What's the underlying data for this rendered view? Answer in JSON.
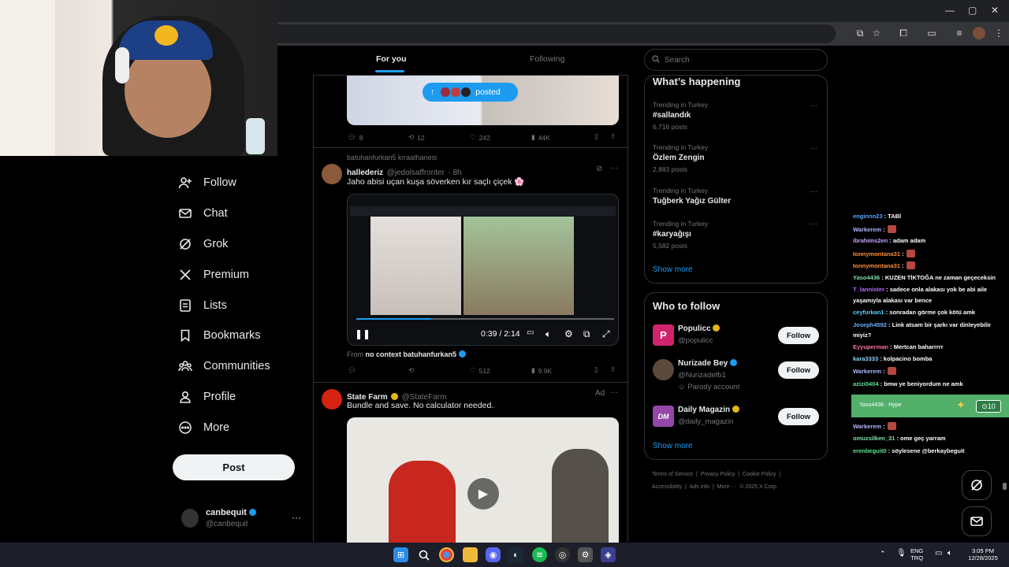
{
  "browser": {
    "window_controls": {
      "minimize": "—",
      "maximize": "▢",
      "close": "✕"
    }
  },
  "nav": {
    "items": [
      {
        "label": "Follow",
        "icon": "add-user-icon"
      },
      {
        "label": "Chat",
        "icon": "mail-icon"
      },
      {
        "label": "Grok",
        "icon": "grok-icon"
      },
      {
        "label": "Premium",
        "icon": "x-logo-icon"
      },
      {
        "label": "Lists",
        "icon": "list-icon"
      },
      {
        "label": "Bookmarks",
        "icon": "bookmark-icon"
      },
      {
        "label": "Communities",
        "icon": "communities-icon"
      },
      {
        "label": "Profile",
        "icon": "person-icon"
      },
      {
        "label": "More",
        "icon": "more-circle-icon"
      }
    ],
    "post_label": "Post",
    "account": {
      "name": "canbequit",
      "handle": "@canbequit"
    }
  },
  "timeline": {
    "tabs": {
      "active": "For you",
      "inactive": "Following"
    },
    "posted_pill": "posted",
    "tweet1": {
      "replies": "8",
      "reposts": "12",
      "likes": "242",
      "views": "44K"
    },
    "tweet2": {
      "repost_line": "batuhanfurkan5 kıraathanesi",
      "name": "hallederiz",
      "handle": "@jedolsaffronter",
      "time": "· 8h",
      "text": "Jaho abisi uçan kuşa söverken kır saçlı çiçek 🌸",
      "video_time": "0:39 / 2:14",
      "video_progress": 0.29,
      "from_prefix": "From",
      "from_account": "no context batuhanfurkan5",
      "reposts": "",
      "likes": "512",
      "views": "9.9K"
    },
    "ad": {
      "name": "State Farm",
      "handle": "@StateFarm",
      "ad_label": "Ad",
      "text": "Bundle and save. No calculator needed."
    }
  },
  "sidebar": {
    "search_placeholder": "Search",
    "whats_happening": {
      "title": "What’s happening",
      "trends": [
        {
          "context": "Trending in Turkey",
          "name": "#sallandık",
          "count": "6,716 posts"
        },
        {
          "context": "Trending in Turkey",
          "name": "Özlem Zengin",
          "count": "2,883 posts"
        },
        {
          "context": "Trending in Turkey",
          "name": "Tuğberk Yağız Gülter",
          "count": ""
        },
        {
          "context": "Trending in Turkey",
          "name": "#karyağışı",
          "count": "5,582 posts"
        }
      ],
      "show_more": "Show more"
    },
    "who_to_follow": {
      "title": "Who to follow",
      "accounts": [
        {
          "name": "Populicc",
          "handle": "@populicc",
          "note": "",
          "badge_color": "#e2b719",
          "avatar_color": "#d2246e",
          "avatar_text": "P"
        },
        {
          "name": "Nurizade Bey",
          "handle": "@Nurizadefb1",
          "note": "Parody account",
          "badge_color": "#1d9bf0",
          "avatar_color": "#5b4a3c",
          "avatar_text": ""
        },
        {
          "name": "Daily Magazin",
          "handle": "@daily_magazin",
          "note": "",
          "badge_color": "#e2b719",
          "avatar_color": "#9447a8",
          "avatar_text": "DM"
        }
      ],
      "follow_label": "Follow",
      "show_more": "Show more"
    },
    "footer": {
      "line1": [
        "Terms of Service",
        "|",
        "Privacy Policy",
        "|",
        "Cookie Policy",
        "|"
      ],
      "line2": [
        "Accessibility",
        "|",
        "Ads info",
        "|",
        "More ···",
        "© 2025 X Corp."
      ]
    }
  },
  "chat": {
    "messages": [
      {
        "user": "enginnn23",
        "color": "#5aa7ff",
        "text": ": TABİ",
        "emote": false
      },
      {
        "user": "Warkerem",
        "color": "#b0b7ff",
        "text": ":",
        "emote": true
      },
      {
        "user": "ibrahims2en",
        "color": "#c7a3ff",
        "text": ": adam adam",
        "emote": false
      },
      {
        "user": "tonnymontana31",
        "color": "#ff8f3a",
        "text": ":",
        "emote": true
      },
      {
        "user": "tonnymontana31",
        "color": "#ff8f3a",
        "text": ":",
        "emote": true
      },
      {
        "user": "Yaso4436",
        "color": "#7ee0a7",
        "text": ": KUZEN TİKTOĞA ne zaman geçeceksin",
        "emote": false
      },
      {
        "user": "T_lannister",
        "color": "#b36bff",
        "text": ": sadece onla alakası yok be abi aile",
        "emote": false
      },
      {
        "user": "",
        "color": "#ffffff",
        "text": "yaşamıyla alakası var bence",
        "emote": false
      },
      {
        "user": "ceyfurkan1",
        "color": "#5fd1ff",
        "text": ": sonradan görme çok kötü amk",
        "emote": false
      },
      {
        "user": "Joseph4592",
        "color": "#6ab1ff",
        "text": ": Link atsam bir şarkı var dinleyebilir",
        "emote": false
      },
      {
        "user": "",
        "color": "#ffffff",
        "text": "miyiz?",
        "emote": false
      },
      {
        "user": "Eyyuperman",
        "color": "#ff6fa8",
        "text": ": Mertcan baharrrrr",
        "emote": false
      },
      {
        "user": "kara3333",
        "color": "#8fd7ff",
        "text": ": kolpacino bomba",
        "emote": false
      },
      {
        "user": "Warkerem",
        "color": "#b0b7ff",
        "text": ":",
        "emote": true
      },
      {
        "user": "azizi0404",
        "color": "#5ee38f",
        "text": ": bmw ye beniyordum ne amk",
        "emote": false
      },
      {
        "user": "Warkerem",
        "color": "#b0b7ff",
        "text": ":",
        "emote": true
      },
      {
        "user": "omuzsilken_31",
        "color": "#7ee0a7",
        "text": ": ome geç yarram",
        "emote": false
      },
      {
        "user": "erenbeguit0",
        "color": "#5ee38f",
        "text": ": söylesene @berkaybeguit",
        "emote": false
      }
    ],
    "hype": {
      "text": "Yaso4436 · Hype",
      "count": "10"
    }
  },
  "taskbar": {
    "lang_top": "ENG",
    "lang_bottom": "TRQ",
    "time": "3:05 PM",
    "date": "12/28/2025"
  }
}
